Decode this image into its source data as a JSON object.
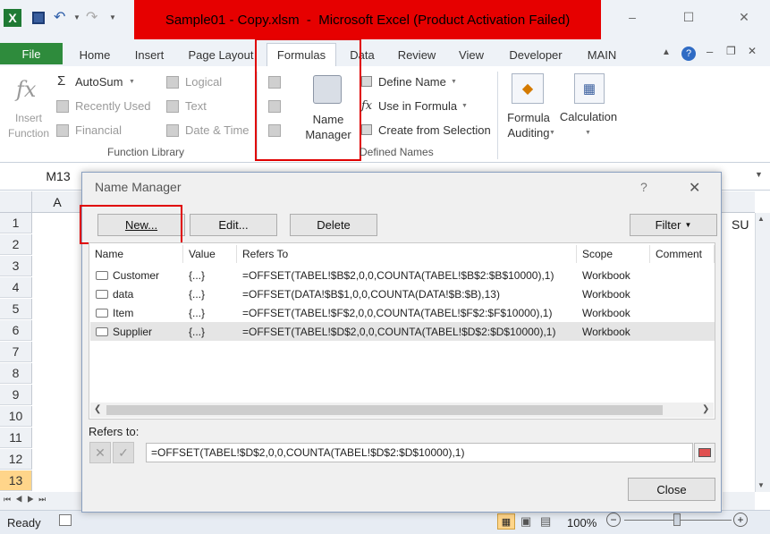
{
  "window": {
    "title": "Sample01 - Copy.xlsm  -  Microsoft Excel (Product Activation Failed)",
    "minimize": "–",
    "maximize": "☐",
    "close": "✕"
  },
  "qat": {
    "app_icon": "X",
    "undo": "↶",
    "redo": "↷"
  },
  "tabs": [
    "File",
    "Home",
    "Insert",
    "Page Layout",
    "Formulas",
    "Data",
    "Review",
    "View",
    "Developer",
    "MAIN"
  ],
  "ribbon": {
    "insert_function": "Insert\nFunction",
    "autosum": "AutoSum",
    "recently_used": "Recently Used",
    "financial": "Financial",
    "logical": "Logical",
    "text": "Text",
    "date_time": "Date & Time",
    "function_library": "Function Library",
    "name_manager": "Name\nManager",
    "define_name": "Define Name",
    "use_in_formula": "Use in Formula",
    "create_from_selection": "Create from Selection",
    "defined_names": "Defined Names",
    "formula_auditing": "Formula\nAuditing",
    "calculation": "Calculation"
  },
  "formula_bar": {
    "name_box": "M13"
  },
  "grid": {
    "col_a": "A",
    "rows": [
      "1",
      "2",
      "3",
      "4",
      "5",
      "6",
      "7",
      "8",
      "9",
      "10",
      "11",
      "12",
      "13"
    ],
    "right_col_text": "SU"
  },
  "dialog": {
    "title": "Name Manager",
    "help": "?",
    "close": "✕",
    "new_label": "New...",
    "edit_label": "Edit...",
    "delete_label": "Delete",
    "filter_label": "Filter",
    "columns": [
      "Name",
      "Value",
      "Refers To",
      "Scope",
      "Comment"
    ],
    "names": [
      {
        "name": "Customer",
        "value": "{...}",
        "refers": "=OFFSET(TABEL!$B$2,0,0,COUNTA(TABEL!$B$2:$B$10000),1)",
        "scope": "Workbook"
      },
      {
        "name": "data",
        "value": "{...}",
        "refers": "=OFFSET(DATA!$B$1,0,0,COUNTA(DATA!$B:$B),13)",
        "scope": "Workbook"
      },
      {
        "name": "Item",
        "value": "{...}",
        "refers": "=OFFSET(TABEL!$F$2,0,0,COUNTA(TABEL!$F$2:$F$10000),1)",
        "scope": "Workbook"
      },
      {
        "name": "Supplier",
        "value": "{...}",
        "refers": "=OFFSET(TABEL!$D$2,0,0,COUNTA(TABEL!$D$2:$D$10000),1)",
        "scope": "Workbook"
      }
    ],
    "refers_to_label": "Refers to:",
    "refers_to_value": "=OFFSET(TABEL!$D$2,0,0,COUNTA(TABEL!$D$2:$D$10000),1)",
    "close_label": "Close"
  },
  "status": {
    "ready": "Ready",
    "zoom": "100%",
    "minus": "−",
    "plus": "+"
  }
}
